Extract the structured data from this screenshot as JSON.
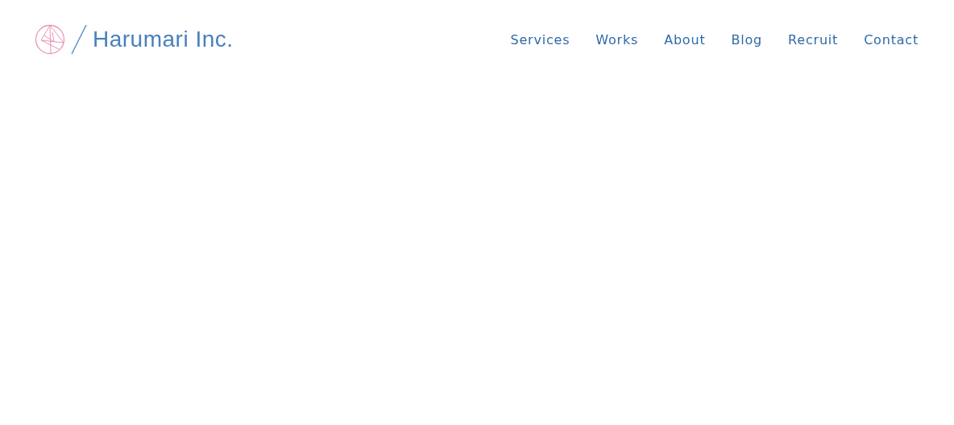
{
  "header": {
    "logo_text": "Harumari Inc.",
    "nav": [
      {
        "label": "Services"
      },
      {
        "label": "Works"
      },
      {
        "label": "About"
      },
      {
        "label": "Blog"
      },
      {
        "label": "Recruit"
      },
      {
        "label": "Contact"
      }
    ]
  }
}
